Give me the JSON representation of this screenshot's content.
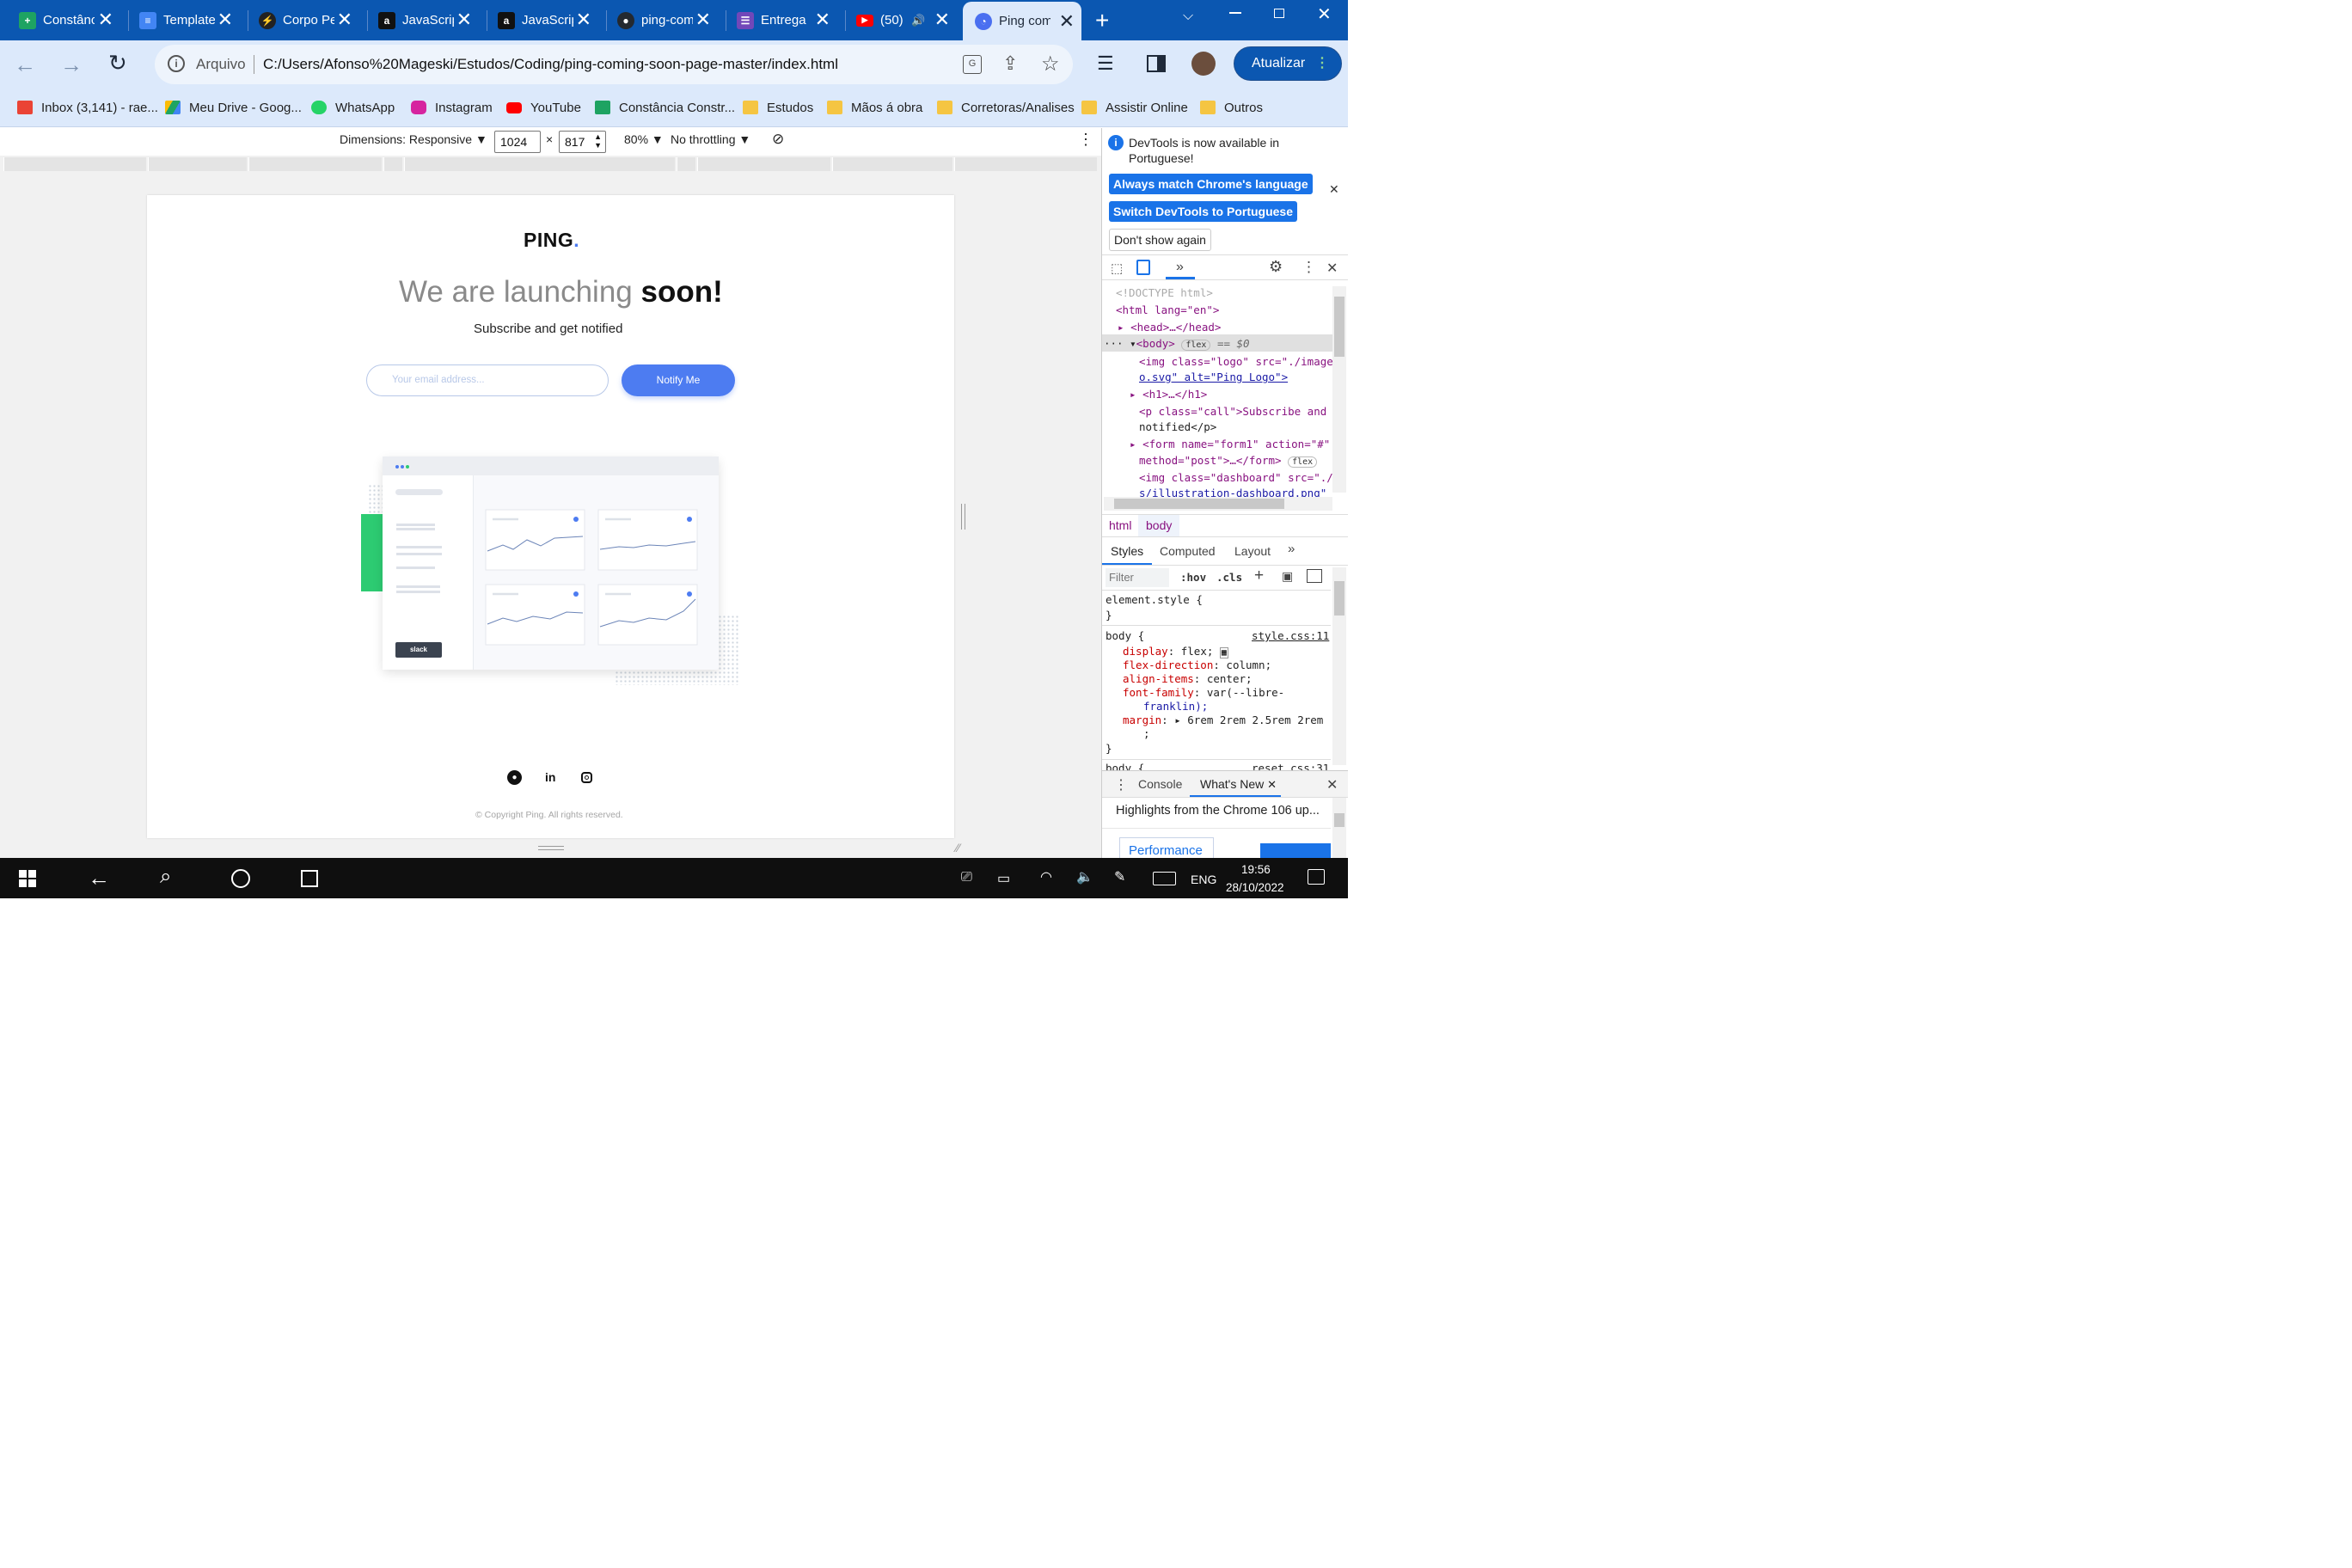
{
  "tabs": [
    {
      "title": "Constânc",
      "color": "#1ea362",
      "glyph": "+"
    },
    {
      "title": "Template",
      "color": "#4285f4",
      "glyph": "≡"
    },
    {
      "title": "Corpo Pe",
      "color": "#222222",
      "glyph": "⚡"
    },
    {
      "title": "JavaScrip",
      "color": "#111111",
      "glyph": "a"
    },
    {
      "title": "JavaScrip",
      "color": "#111111",
      "glyph": "a"
    },
    {
      "title": "ping-com",
      "color": "#24292f",
      "glyph": "◯"
    },
    {
      "title": "Entrega",
      "color": "#7248b9",
      "glyph": "☰"
    },
    {
      "title": "(50)",
      "color": "#ff0000",
      "glyph": "▶"
    },
    {
      "title": "Ping com",
      "color": "#4a6ff0",
      "glyph": "◔"
    }
  ],
  "omnibox": {
    "scheme": "Arquivo",
    "url": "C:/Users/Afonso%20Mageski/Estudos/Coding/ping-coming-soon-page-master/index.html"
  },
  "update_label": "Atualizar",
  "bookmarks": [
    {
      "label": "Inbox (3,141) - rae...",
      "color": "#ea4335"
    },
    {
      "label": "Meu Drive - Goog...",
      "color": "#1fa463"
    },
    {
      "label": "WhatsApp",
      "color": "#25d366"
    },
    {
      "label": "Instagram",
      "color": "#d6249f"
    },
    {
      "label": "YouTube",
      "color": "#ff0000"
    },
    {
      "label": "Constância Constr...",
      "color": "#1ea362"
    },
    {
      "label": "Estudos",
      "color": "#f5c542"
    },
    {
      "label": "Mãos á obra",
      "color": "#f5c542"
    },
    {
      "label": "Corretoras/Analises",
      "color": "#f5c542"
    },
    {
      "label": "Assistir Online",
      "color": "#f5c542"
    },
    {
      "label": "Outros",
      "color": "#f5c542"
    }
  ],
  "device_toolbar": {
    "dimensions": "Dimensions: Responsive",
    "width": "1024",
    "x": "×",
    "height": "817",
    "zoom": "80%",
    "throttle": "No throttling"
  },
  "site": {
    "logo": "PING",
    "logo_dot": ".",
    "headline_light": "We are launching ",
    "headline_bold": "soon!",
    "subtitle": "Subscribe and get notified",
    "email_placeholder": "Your email address...",
    "notify_label": "Notify Me",
    "slack_label": "slack",
    "copyright": "© Copyright Ping. All rights reserved.",
    "accent": "#4d7cf1"
  },
  "devtools": {
    "notice": "DevTools is now available in",
    "notice2": "Portuguese!",
    "btn_match": "Always match Chrome's language",
    "btn_switch": "Switch DevTools to Portuguese",
    "btn_dont": "Don't show again",
    "dom": {
      "l1": "<!DOCTYPE html>",
      "l2": "<html lang=\"en\">",
      "l3": "<head>…</head>",
      "l4": "<body>",
      "l4badge": "flex",
      "l4eq": "== $0",
      "l5a": "<img class=\"logo\" src=\"./image",
      "l5b": "o.svg\" alt=\"Ping Logo\">",
      "l6": "<h1>…</h1>",
      "l7a": "<p class=\"call\">Subscribe and",
      "l7b": "notified</p>",
      "l8a": "<form name=\"form1\" action=\"#\"",
      "l8b": "method=\"post\">…</form>",
      "l8badge": "flex",
      "l9a": "<img class=\"dashboard\" src=\"./",
      "l9b": "s/illustration-dashboard.png\""
    },
    "crumbs": [
      "html",
      "body"
    ],
    "panes": [
      "Styles",
      "Computed",
      "Layout"
    ],
    "filter": "Filter",
    "hov": ":hov",
    "cls": ".cls",
    "styles": {
      "el": "element.style {",
      "close": "}",
      "body_sel": "body {",
      "src": "style.css:11",
      "p1k": "display",
      "p1v": "flex;",
      "p2k": "flex-direction",
      "p2v": "column;",
      "p3k": "align-items",
      "p3v": "center;",
      "p4k": "font-family",
      "p4v": "var(--libre-",
      "p4v2": "franklin);",
      "p5k": "margin",
      "p5v": "6rem 2rem 2.5rem 2rem",
      "p5v2": ";",
      "next_sel": "body {",
      "next_src": "reset.css:31"
    },
    "drawer_tabs": [
      "Console",
      "What's New"
    ],
    "drawer_text": "Highlights from the Chrome 106 up...",
    "drawer_btn": "Performance"
  },
  "taskbar": {
    "lang": "ENG",
    "time": "19:56",
    "date": "28/10/2022"
  }
}
